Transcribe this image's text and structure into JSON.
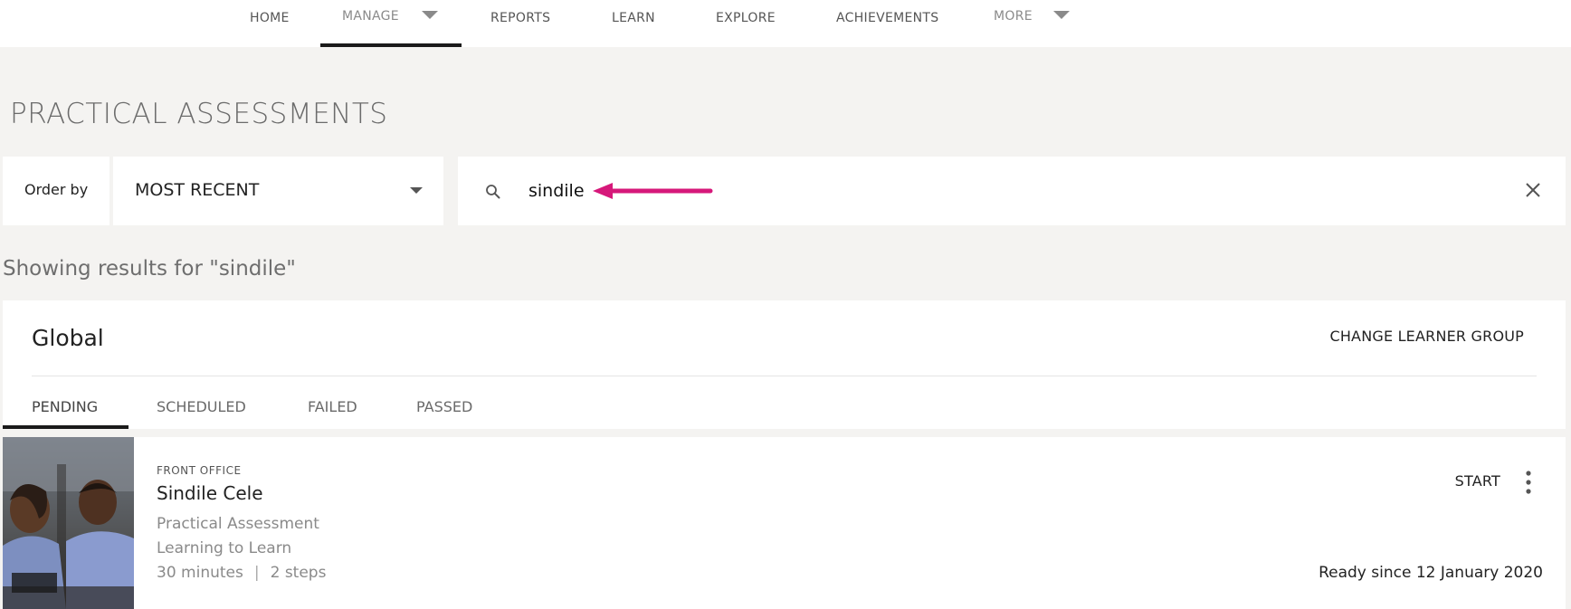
{
  "nav": {
    "items": [
      {
        "label": "HOME"
      },
      {
        "label": "MANAGE"
      },
      {
        "label": "REPORTS"
      },
      {
        "label": "LEARN"
      },
      {
        "label": "EXPLORE"
      },
      {
        "label": "ACHIEVEMENTS"
      },
      {
        "label": "MORE"
      }
    ],
    "active": "MANAGE"
  },
  "page": {
    "title": "PRACTICAL ASSESSMENTS"
  },
  "filters": {
    "order_label": "Order by",
    "order_value": "MOST RECENT",
    "search_value": "sindile"
  },
  "results": {
    "label": "Showing results for \"sindile\""
  },
  "group": {
    "title": "Global",
    "change_label": "CHANGE LEARNER GROUP",
    "tabs": [
      {
        "label": "PENDING"
      },
      {
        "label": "SCHEDULED"
      },
      {
        "label": "FAILED"
      },
      {
        "label": "PASSED"
      }
    ],
    "active_tab": "PENDING"
  },
  "assessment": {
    "department": "FRONT OFFICE",
    "name": "Sindile Cele",
    "type": "Practical Assessment",
    "course": "Learning to Learn",
    "duration": "30 minutes",
    "steps": "2 steps",
    "separator": "|",
    "start_label": "START",
    "ready_text": "Ready since 12 January 2020"
  },
  "colors": {
    "accent_arrow": "#d6187a",
    "background": "#f4f3f1",
    "active_underline": "#1a1a1a"
  }
}
